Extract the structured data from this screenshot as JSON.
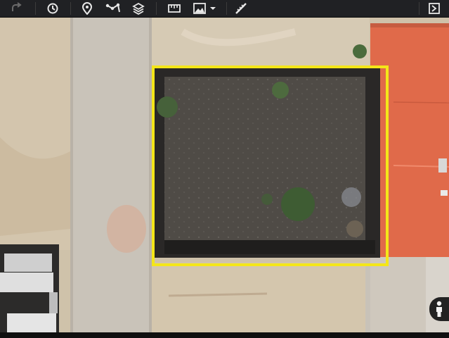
{
  "toolbar": {
    "tools": [
      {
        "name": "redo-icon"
      },
      {
        "name": "history-imagery-icon"
      },
      {
        "name": "add-placemark-icon"
      },
      {
        "name": "add-path-icon"
      },
      {
        "name": "layers-icon"
      },
      {
        "name": "ruler-icon"
      },
      {
        "name": "image-overlay-icon"
      },
      {
        "name": "dropdown-caret-icon"
      },
      {
        "name": "measure-icon"
      },
      {
        "name": "exit-icon"
      }
    ]
  },
  "map": {
    "selection_color": "#f4e619",
    "roof_color": "#e06a4a",
    "road_color": "#c9c3b9",
    "lot_color": "#4f4b46"
  },
  "streetview": {
    "icon": "pegman-icon"
  }
}
